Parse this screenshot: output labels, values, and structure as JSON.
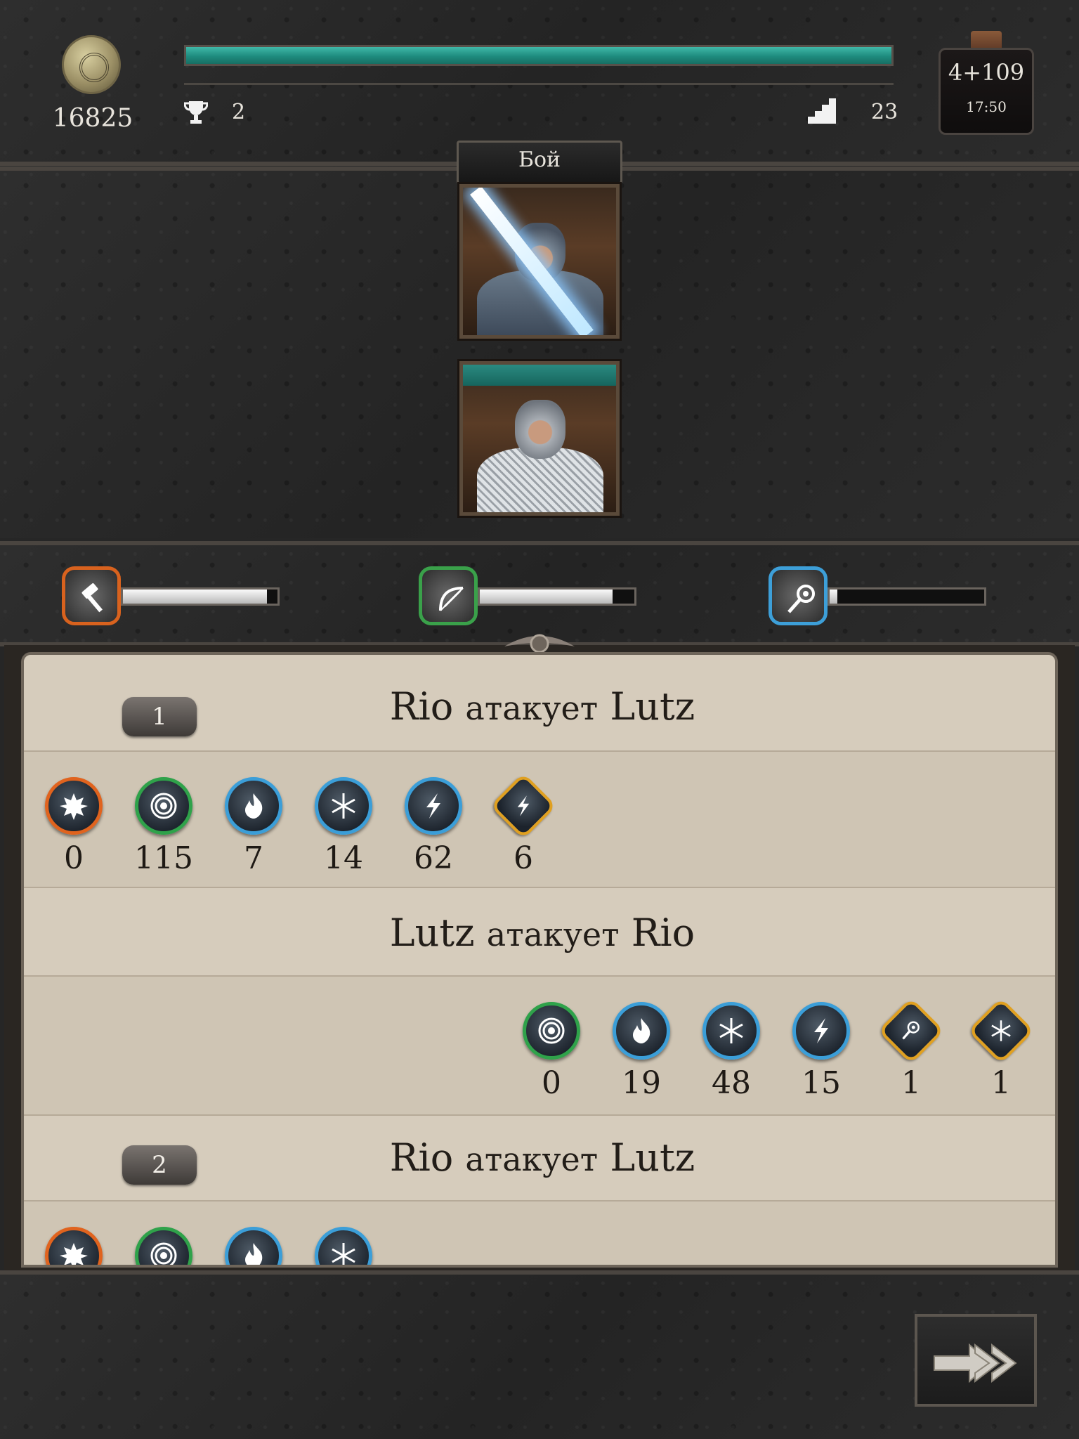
{
  "header": {
    "gold": "16825",
    "trophies": "2",
    "level": "23",
    "xp_progress": 1.0,
    "potion": {
      "value": "4+109",
      "timer": "17:50"
    }
  },
  "battle": {
    "title": "Бой",
    "player_hp_progress": 1.0
  },
  "skills": [
    {
      "icon": "hammer-icon",
      "color": "#d8621e",
      "progress": 0.93
    },
    {
      "icon": "bow-icon",
      "color": "#3aa14a",
      "progress": 0.86
    },
    {
      "icon": "staff-icon",
      "color": "#3d9fd8",
      "progress": 0.05
    }
  ],
  "log": {
    "round1": {
      "number": "1",
      "attacker": "Rio",
      "verb": "атакует",
      "target": "Lutz",
      "stats": [
        {
          "icon": "burst-icon",
          "value": "0"
        },
        {
          "icon": "target-icon",
          "value": "115"
        },
        {
          "icon": "fire-icon",
          "value": "7"
        },
        {
          "icon": "snowflake-icon",
          "value": "14"
        },
        {
          "icon": "lightning-icon",
          "value": "62"
        },
        {
          "icon": "lightning-resist-icon",
          "value": "6"
        }
      ]
    },
    "counter1": {
      "attacker": "Lutz",
      "verb": "атакует",
      "target": "Rio",
      "stats": [
        {
          "icon": "target-icon",
          "value": "0"
        },
        {
          "icon": "fire-icon",
          "value": "19"
        },
        {
          "icon": "snowflake-icon",
          "value": "48"
        },
        {
          "icon": "lightning-icon",
          "value": "15"
        },
        {
          "icon": "staff-bonus-icon",
          "value": "1"
        },
        {
          "icon": "snowflake-resist-icon",
          "value": "1"
        }
      ]
    },
    "round2": {
      "number": "2",
      "attacker": "Rio",
      "verb": "атакует",
      "target": "Lutz"
    }
  }
}
